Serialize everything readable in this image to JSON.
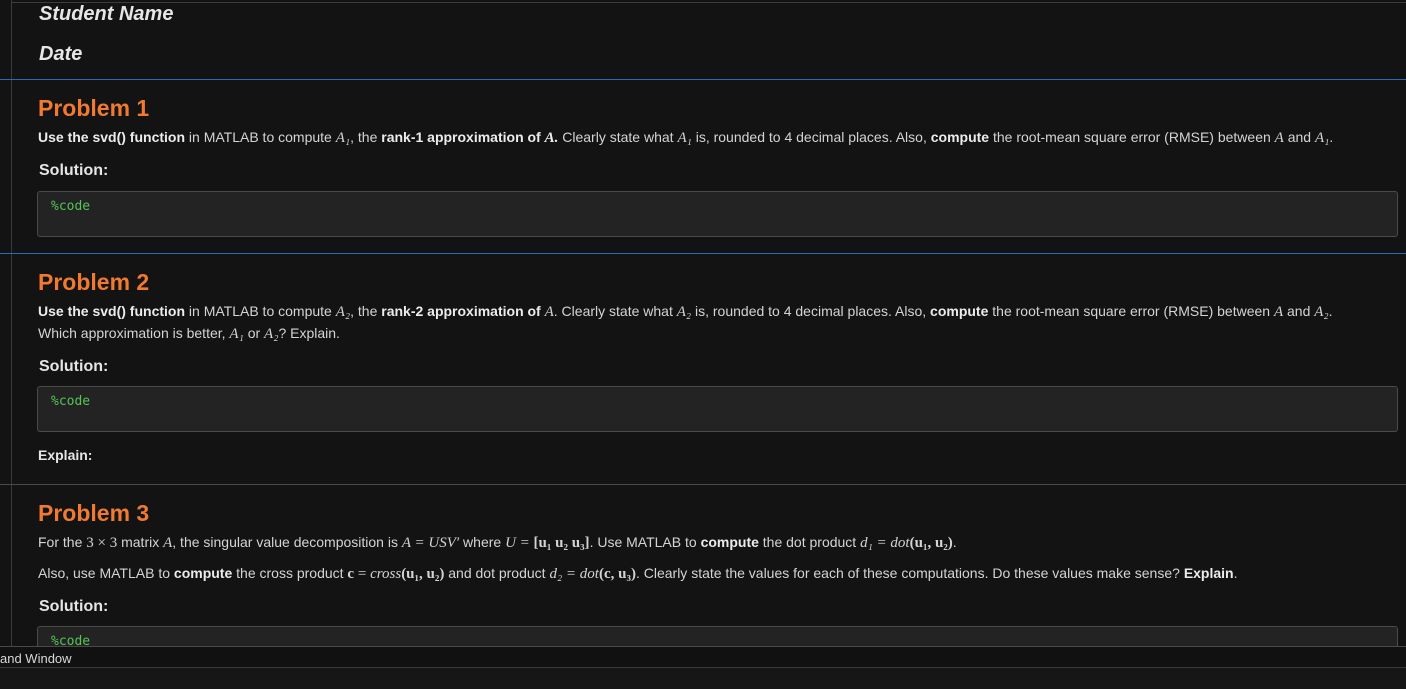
{
  "header": {
    "student_name": "Student Name",
    "date": "Date"
  },
  "problem1": {
    "title": "Problem 1",
    "t1": "Use the svd() function",
    "t2": " in MATLAB to compute ",
    "A1": "A₁",
    "t3": ", the ",
    "t4": "rank-1 approximation of ",
    "A": "A.",
    "t5": " Clearly state what ",
    "t6": " is, rounded to 4 decimal places. Also, ",
    "t7": "compute",
    "t8": " the root-mean square error (RMSE) between ",
    "t9": " and ",
    "A_plain": "A",
    "end": ".",
    "solution_label": "Solution:",
    "code": "%code"
  },
  "problem2": {
    "title": "Problem 2",
    "t1": "Use the svd() function",
    "t2": " in MATLAB to compute ",
    "A2": "A₂",
    "t3": ", the ",
    "t4": "rank-2 approximation of ",
    "A": "A",
    "t5": ". Clearly state what ",
    "t6": " is, rounded to 4 decimal places. Also, ",
    "t7": "compute",
    "t8": " the root-mean square error (RMSE) between ",
    "t9": " and ",
    "end": ".",
    "l2a": "Which approximation is better, ",
    "A1": "A₁",
    "or": " or ",
    "l2b": "? Explain.",
    "solution_label": "Solution:",
    "code": "%code",
    "explain_label": "Explain:"
  },
  "problem3": {
    "title": "Problem 3",
    "a1": "For the ",
    "dim": "3 × 3",
    "a2": " matrix ",
    "A": "A",
    "a3": ", the singular value decomposition is ",
    "svd": "A = USV′",
    "a4": " where ",
    "U": "U = ",
    "Uvec": "[u₁ u₂ u₃]",
    "a5": ". Use MATLAB to ",
    "compute": "compute",
    "a6": " the dot product ",
    "d1": "d₁ = dot",
    "d1args": "(u₁, u₂)",
    "a7": ".",
    "b1": "Also, use MATLAB to ",
    "b2": " the cross product ",
    "c": "c",
    "b3": " = ",
    "cross": "cross",
    "crossargs": "(u₁, u₂)",
    "b4": " and dot product ",
    "d2": "d₂ = dot",
    "d2args": "(c, u₃)",
    "b5": ". Clearly state the values for each of these computations. Do these values make sense? ",
    "explain": "Explain",
    "b6": ".",
    "solution_label": "Solution:",
    "code": "%code"
  },
  "command_window": {
    "title": "and Window"
  }
}
